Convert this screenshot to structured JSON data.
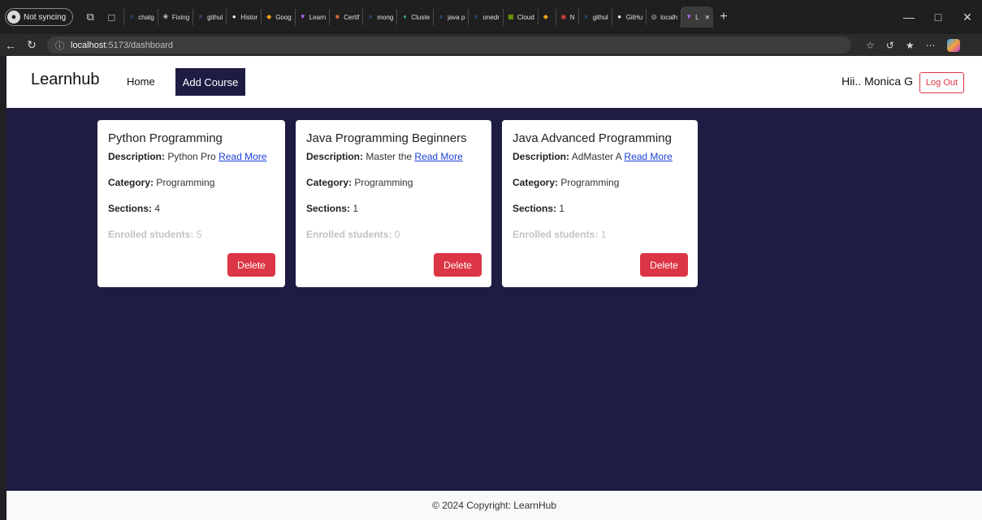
{
  "browser": {
    "profile_label": "Not syncing",
    "tabs": [
      {
        "label": "chatg",
        "icon": "search-icon",
        "color": "#4a8cff"
      },
      {
        "label": "Fixing",
        "icon": "chatgpt-icon",
        "color": "#cfcfcf"
      },
      {
        "label": "githul",
        "icon": "search-icon",
        "color": "#4a8cff"
      },
      {
        "label": "Histor",
        "icon": "github-icon",
        "color": "#ffffff"
      },
      {
        "label": "Goog",
        "icon": "google-cloud-icon",
        "color": "#f2a31b"
      },
      {
        "label": "Learn",
        "icon": "vite-icon",
        "color": "#b06bff"
      },
      {
        "label": "Certif",
        "icon": "certificate-icon",
        "color": "#d86a4a"
      },
      {
        "label": "mong",
        "icon": "search-icon",
        "color": "#4a8cff"
      },
      {
        "label": "Cluste",
        "icon": "mongodb-leaf-icon",
        "color": "#36b37e"
      },
      {
        "label": "java p",
        "icon": "search-icon",
        "color": "#4a8cff"
      },
      {
        "label": "onedr",
        "icon": "search-icon",
        "color": "#4a8cff"
      },
      {
        "label": "Cloud",
        "icon": "microsoft-icon",
        "color": "#7fba00"
      },
      {
        "label": "",
        "icon": "google-cloud-icon",
        "color": "#f2a31b"
      },
      {
        "label": "N",
        "icon": "record-icon",
        "color": "#e0443a"
      },
      {
        "label": "githul",
        "icon": "search-icon",
        "color": "#4a8cff"
      },
      {
        "label": "GitHu",
        "icon": "github-icon",
        "color": "#ffffff"
      },
      {
        "label": "localh",
        "icon": "globe-icon",
        "color": "#cfcfcf"
      },
      {
        "label": "L",
        "icon": "vite-icon",
        "color": "#b06bff",
        "active": true
      }
    ],
    "url_host": "localhost",
    "url_path": ":5173/dashboard"
  },
  "navbar": {
    "brand": "Learnhub",
    "home": "Home",
    "add_course": "Add Course",
    "greeting": "Hii.. Monica G",
    "logout": "Log Out"
  },
  "courses": [
    {
      "title": "Python Programming",
      "desc_label": "Description:",
      "desc": "Python Pro",
      "read_more": "Read More",
      "cat_label": "Category:",
      "category": "Programming",
      "sec_label": "Sections:",
      "sections": "4",
      "enr_label": "Enrolled students:",
      "enrolled": "5",
      "delete": "Delete"
    },
    {
      "title": "Java Programming Beginners",
      "desc_label": "Description:",
      "desc": "Master the",
      "read_more": "Read More",
      "cat_label": "Category:",
      "category": "Programming",
      "sec_label": "Sections:",
      "sections": "1",
      "enr_label": "Enrolled students:",
      "enrolled": "0",
      "delete": "Delete"
    },
    {
      "title": "Java Advanced Programming",
      "desc_label": "Description:",
      "desc": "AdMaster A",
      "read_more": "Read More",
      "cat_label": "Category:",
      "category": "Programming",
      "sec_label": "Sections:",
      "sections": "1",
      "enr_label": "Enrolled students:",
      "enrolled": "1",
      "delete": "Delete"
    }
  ],
  "footer": {
    "text": "© 2024 Copyright: LearnHub"
  },
  "colors": {
    "primary": "#1e1c42",
    "danger": "#dc3545",
    "link": "#1a3fd6"
  }
}
